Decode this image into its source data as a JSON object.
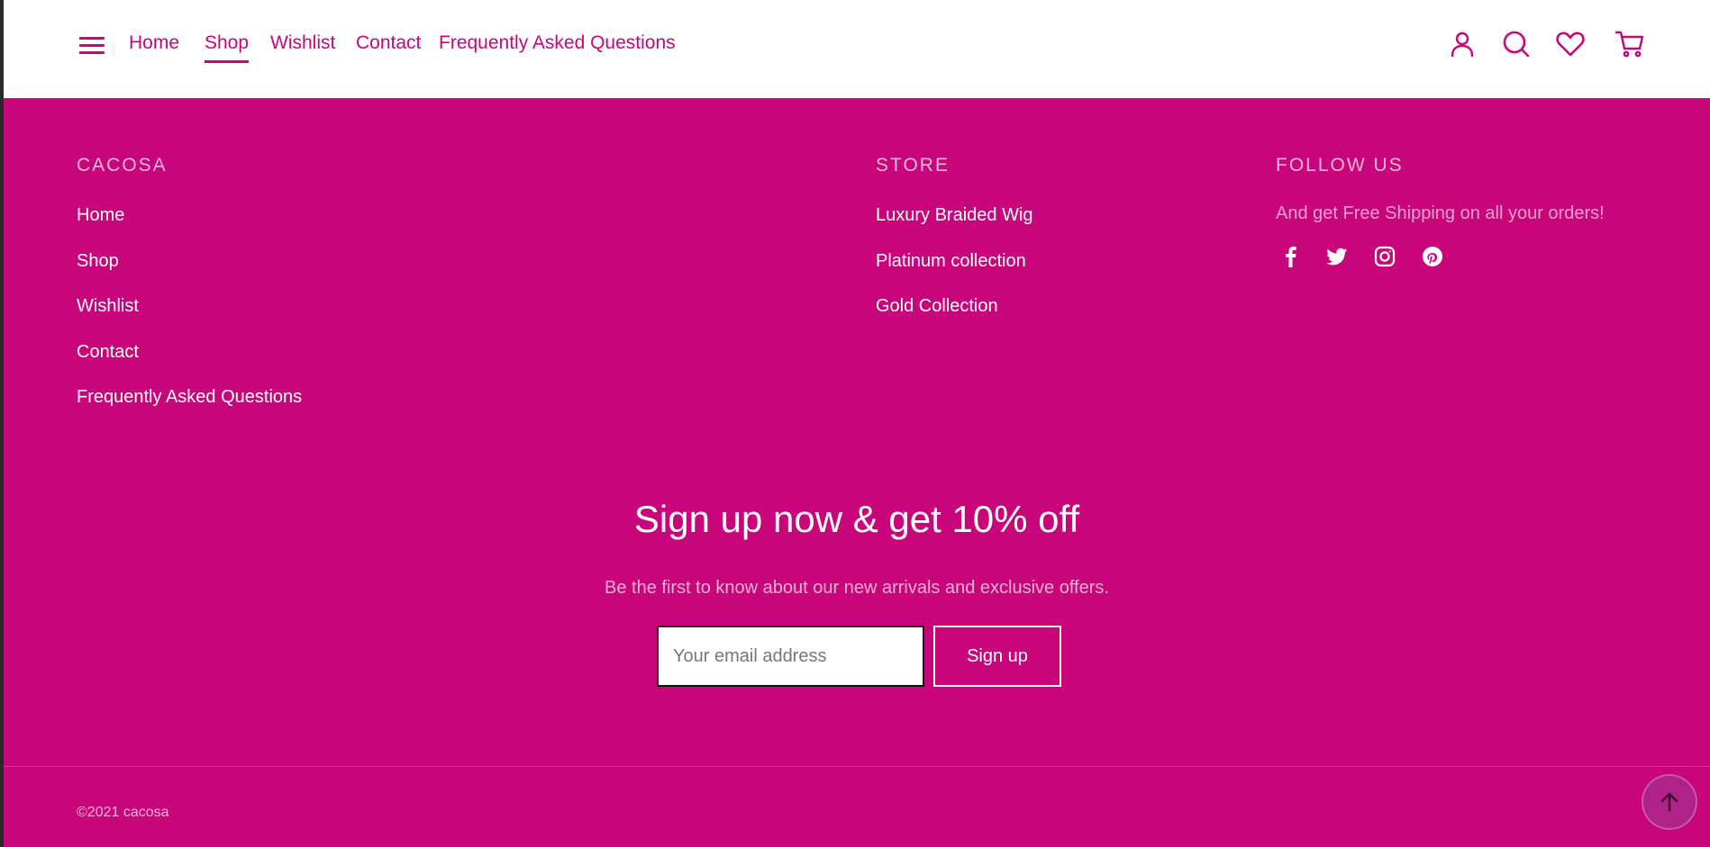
{
  "header": {
    "nav": [
      {
        "label": "Home",
        "active": false
      },
      {
        "label": "Shop",
        "active": true
      },
      {
        "label": "Wishlist",
        "active": false
      },
      {
        "label": "Contact",
        "active": false
      },
      {
        "label": "Frequently Asked Questions",
        "active": false
      }
    ],
    "icons": [
      "user-icon",
      "search-icon",
      "heart-icon",
      "cart-icon"
    ]
  },
  "footer": {
    "brand_col": {
      "title": "CACOSA",
      "links": [
        "Home",
        "Shop",
        "Wishlist",
        "Contact",
        "Frequently Asked Questions"
      ]
    },
    "store_col": {
      "title": "STORE",
      "links": [
        "Luxury Braided Wig",
        "Platinum collection",
        "Gold Collection"
      ]
    },
    "follow_col": {
      "title": "FOLLOW US",
      "text": "And get Free Shipping on all your orders!",
      "socials": [
        "facebook-icon",
        "twitter-icon",
        "instagram-icon",
        "pinterest-icon"
      ]
    },
    "newsletter": {
      "title": "Sign up now & get 10% off",
      "subtitle": "Be the first to know about our new arrivals and exclusive offers.",
      "email_placeholder": "Your email address",
      "button": "Sign up"
    },
    "copyright": "©2021 cacosa"
  },
  "colors": {
    "brand": "#c8057a",
    "header_bg": "#ffffff"
  }
}
